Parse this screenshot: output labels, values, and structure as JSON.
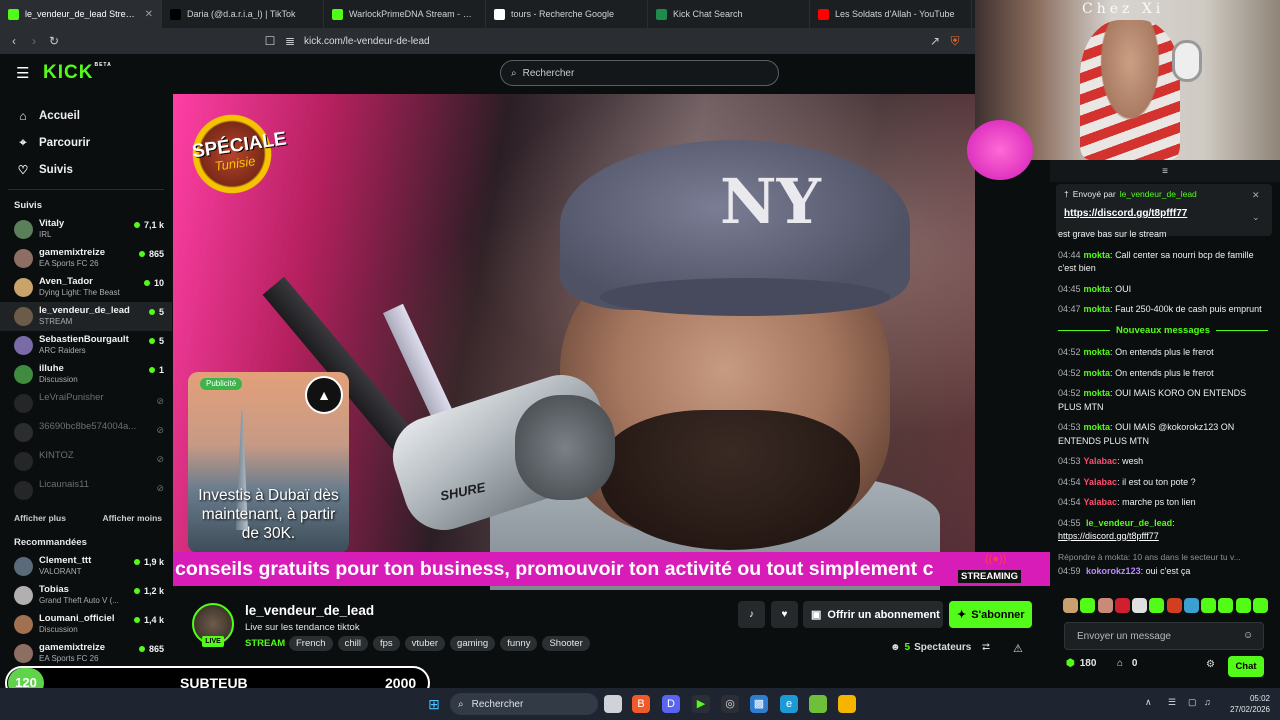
{
  "browser": {
    "tabs": [
      {
        "title": "le_vendeur_de_lead Stream - W",
        "icon_color": "#53fc18",
        "active": true
      },
      {
        "title": "Daria (@d.a.r.i.a_l) | TikTok",
        "icon_color": "#000000",
        "active": false
      },
      {
        "title": "WarlockPrimeDNA Stream - Watch",
        "icon_color": "#53fc18",
        "active": false
      },
      {
        "title": "tours - Recherche Google",
        "icon_color": "#ffffff",
        "active": false
      },
      {
        "title": "Kick Chat Search",
        "icon_color": "#1f8a4c",
        "active": false
      },
      {
        "title": "Les Soldats d'Allah - YouTube",
        "icon_color": "#ff0000",
        "active": false
      }
    ],
    "url": "kick.com/le-vendeur-de-lead"
  },
  "kick": {
    "logo": "KICK",
    "logo_badge": "BETA",
    "search_placeholder": "Rechercher",
    "accent": "#53fc18"
  },
  "sidebar": {
    "nav": [
      {
        "label": "Accueil",
        "icon": "home-icon"
      },
      {
        "label": "Parcourir",
        "icon": "compass-icon"
      },
      {
        "label": "Suivis",
        "icon": "heart-icon"
      }
    ],
    "followed_title": "Suivis",
    "followed": [
      {
        "name": "Vitaly",
        "category": "IRL",
        "viewers": "7,1 k",
        "live": true,
        "color": "#5a7f5a"
      },
      {
        "name": "gamemixtreize",
        "category": "EA Sports FC 26",
        "viewers": "865",
        "live": true,
        "color": "#8d6e63"
      },
      {
        "name": "Aven_Tador",
        "category": "Dying Light: The Beast",
        "viewers": "10",
        "live": true,
        "color": "#c9a36a"
      },
      {
        "name": "le_vendeur_de_lead",
        "category": "STREAM",
        "viewers": "5",
        "live": true,
        "color": "#6d5b4a",
        "selected": true
      },
      {
        "name": "SebastienBourgault",
        "category": "ARC Raiders",
        "viewers": "5",
        "live": true,
        "color": "#7a6aa8"
      },
      {
        "name": "illuhe",
        "category": "Discussion",
        "viewers": "1",
        "live": true,
        "color": "#3f8c3f"
      },
      {
        "name": "LeVraiPunisher",
        "category": "",
        "viewers": "",
        "live": false,
        "color": "#444"
      },
      {
        "name": "36690bc8be574004a...",
        "category": "",
        "viewers": "",
        "live": false,
        "color": "#555"
      },
      {
        "name": "KINTOZ",
        "category": "",
        "viewers": "",
        "live": false,
        "color": "#444"
      },
      {
        "name": "Licaunais11",
        "category": "",
        "viewers": "",
        "live": false,
        "color": "#444"
      }
    ],
    "show_more": "Afficher plus",
    "show_less": "Afficher moins",
    "recommended_title": "Recommandées",
    "recommended": [
      {
        "name": "Clement_ttt",
        "category": "VALORANT",
        "viewers": "1,9 k",
        "color": "#5b6a7a"
      },
      {
        "name": "Tobias",
        "category": "Grand Theft Auto V (...",
        "viewers": "1,2 k",
        "color": "#b0b0b0"
      },
      {
        "name": "Loumani_officiel",
        "category": "Discussion",
        "viewers": "1,4 k",
        "color": "#a07050"
      },
      {
        "name": "gamemixtreize",
        "category": "EA Sports FC 26",
        "viewers": "865",
        "color": "#8d6e63"
      }
    ]
  },
  "video": {
    "badge_line1": "SPÉCIALE",
    "badge_line2": "Tunisie",
    "ad_label": "Publicité",
    "ad_text": "Investis à Dubaï dès maintenant, à partir de 30K.",
    "ticker": "conseils gratuits pour ton business, promouvoir ton activité ou tout simplement c",
    "streaming_label": "STREAMING",
    "mic_brand": "SHURE",
    "cap_logo": "NY",
    "cam_title": "Chez Xi"
  },
  "chat": {
    "pinned_by_label": "Envoyé par",
    "pinned_user": "le_vendeur_de_lead",
    "pinned_link": "https://discord.gg/t8pfff77",
    "old_messages": [
      {
        "time": "",
        "user": "",
        "text": "est grave bas sur le stream",
        "color": "#ffffff"
      },
      {
        "time": "04:44",
        "user": "mokta",
        "text": "Call center sa nourri bcp de famille c'est bien",
        "color": "#53fc18"
      },
      {
        "time": "04:45",
        "user": "mokta",
        "text": "OUI",
        "color": "#53fc18"
      },
      {
        "time": "04:47",
        "user": "mokta",
        "text": "Faut 250-400k de cash puis emprunt",
        "color": "#53fc18"
      }
    ],
    "new_messages_label": "Nouveaux messages",
    "new_messages": [
      {
        "time": "04:52",
        "user": "mokta",
        "text": "On entends plus le frerot",
        "color": "#53fc18"
      },
      {
        "time": "04:52",
        "user": "mokta",
        "text": "On entends plus le frerot",
        "color": "#53fc18"
      },
      {
        "time": "04:52",
        "user": "mokta",
        "text": "OUI MAIS KORO ON ENTENDS PLUS MTN",
        "color": "#53fc18"
      },
      {
        "time": "04:53",
        "user": "mokta",
        "text": "OUI MAIS @kokorokz123 ON ENTENDS PLUS MTN",
        "color": "#53fc18"
      },
      {
        "time": "04:53",
        "user": "Yalabac",
        "text": "wesh",
        "color": "#ff4d6d"
      },
      {
        "time": "04:54",
        "user": "Yalabac",
        "text": "il est ou ton pote ?",
        "color": "#ff4d6d"
      },
      {
        "time": "04:54",
        "user": "Yalabac",
        "text": "marche ps ton lien",
        "color": "#ff4d6d"
      }
    ],
    "streamer_msg": {
      "time": "04:55",
      "user": "le_vendeur_de_lead",
      "link": "https://discord.gg/t8pfff77",
      "color": "#53fc18"
    },
    "reply_preview": "Répondre à mokta: 10 ans dans le secteur tu v...",
    "last_msg": {
      "time": "04:59",
      "user": "kokorokz123",
      "text": "oui c'est ça",
      "color": "#b98cff"
    },
    "input_placeholder": "Envoyer un message",
    "points": "180",
    "gifts": "0",
    "send_label": "Chat"
  },
  "stream": {
    "name": "le_vendeur_de_lead",
    "title": "Live sur les tendance tiktok",
    "category": "STREAM",
    "live_label": "LIVE",
    "tags": [
      "French",
      "chill",
      "fps",
      "vtuber",
      "gaming",
      "funny",
      "Shooter"
    ],
    "gift_label": "Offrir un abonnement",
    "subscribe_label": "S'abonner",
    "viewers_count": "5",
    "viewers_label": "Spectateurs"
  },
  "subgoal": {
    "current": "120",
    "label": "SUBTEUB",
    "target": "2000"
  },
  "taskbar": {
    "search_placeholder": "Rechercher",
    "time": "05:02",
    "date": "27/02/2026"
  }
}
